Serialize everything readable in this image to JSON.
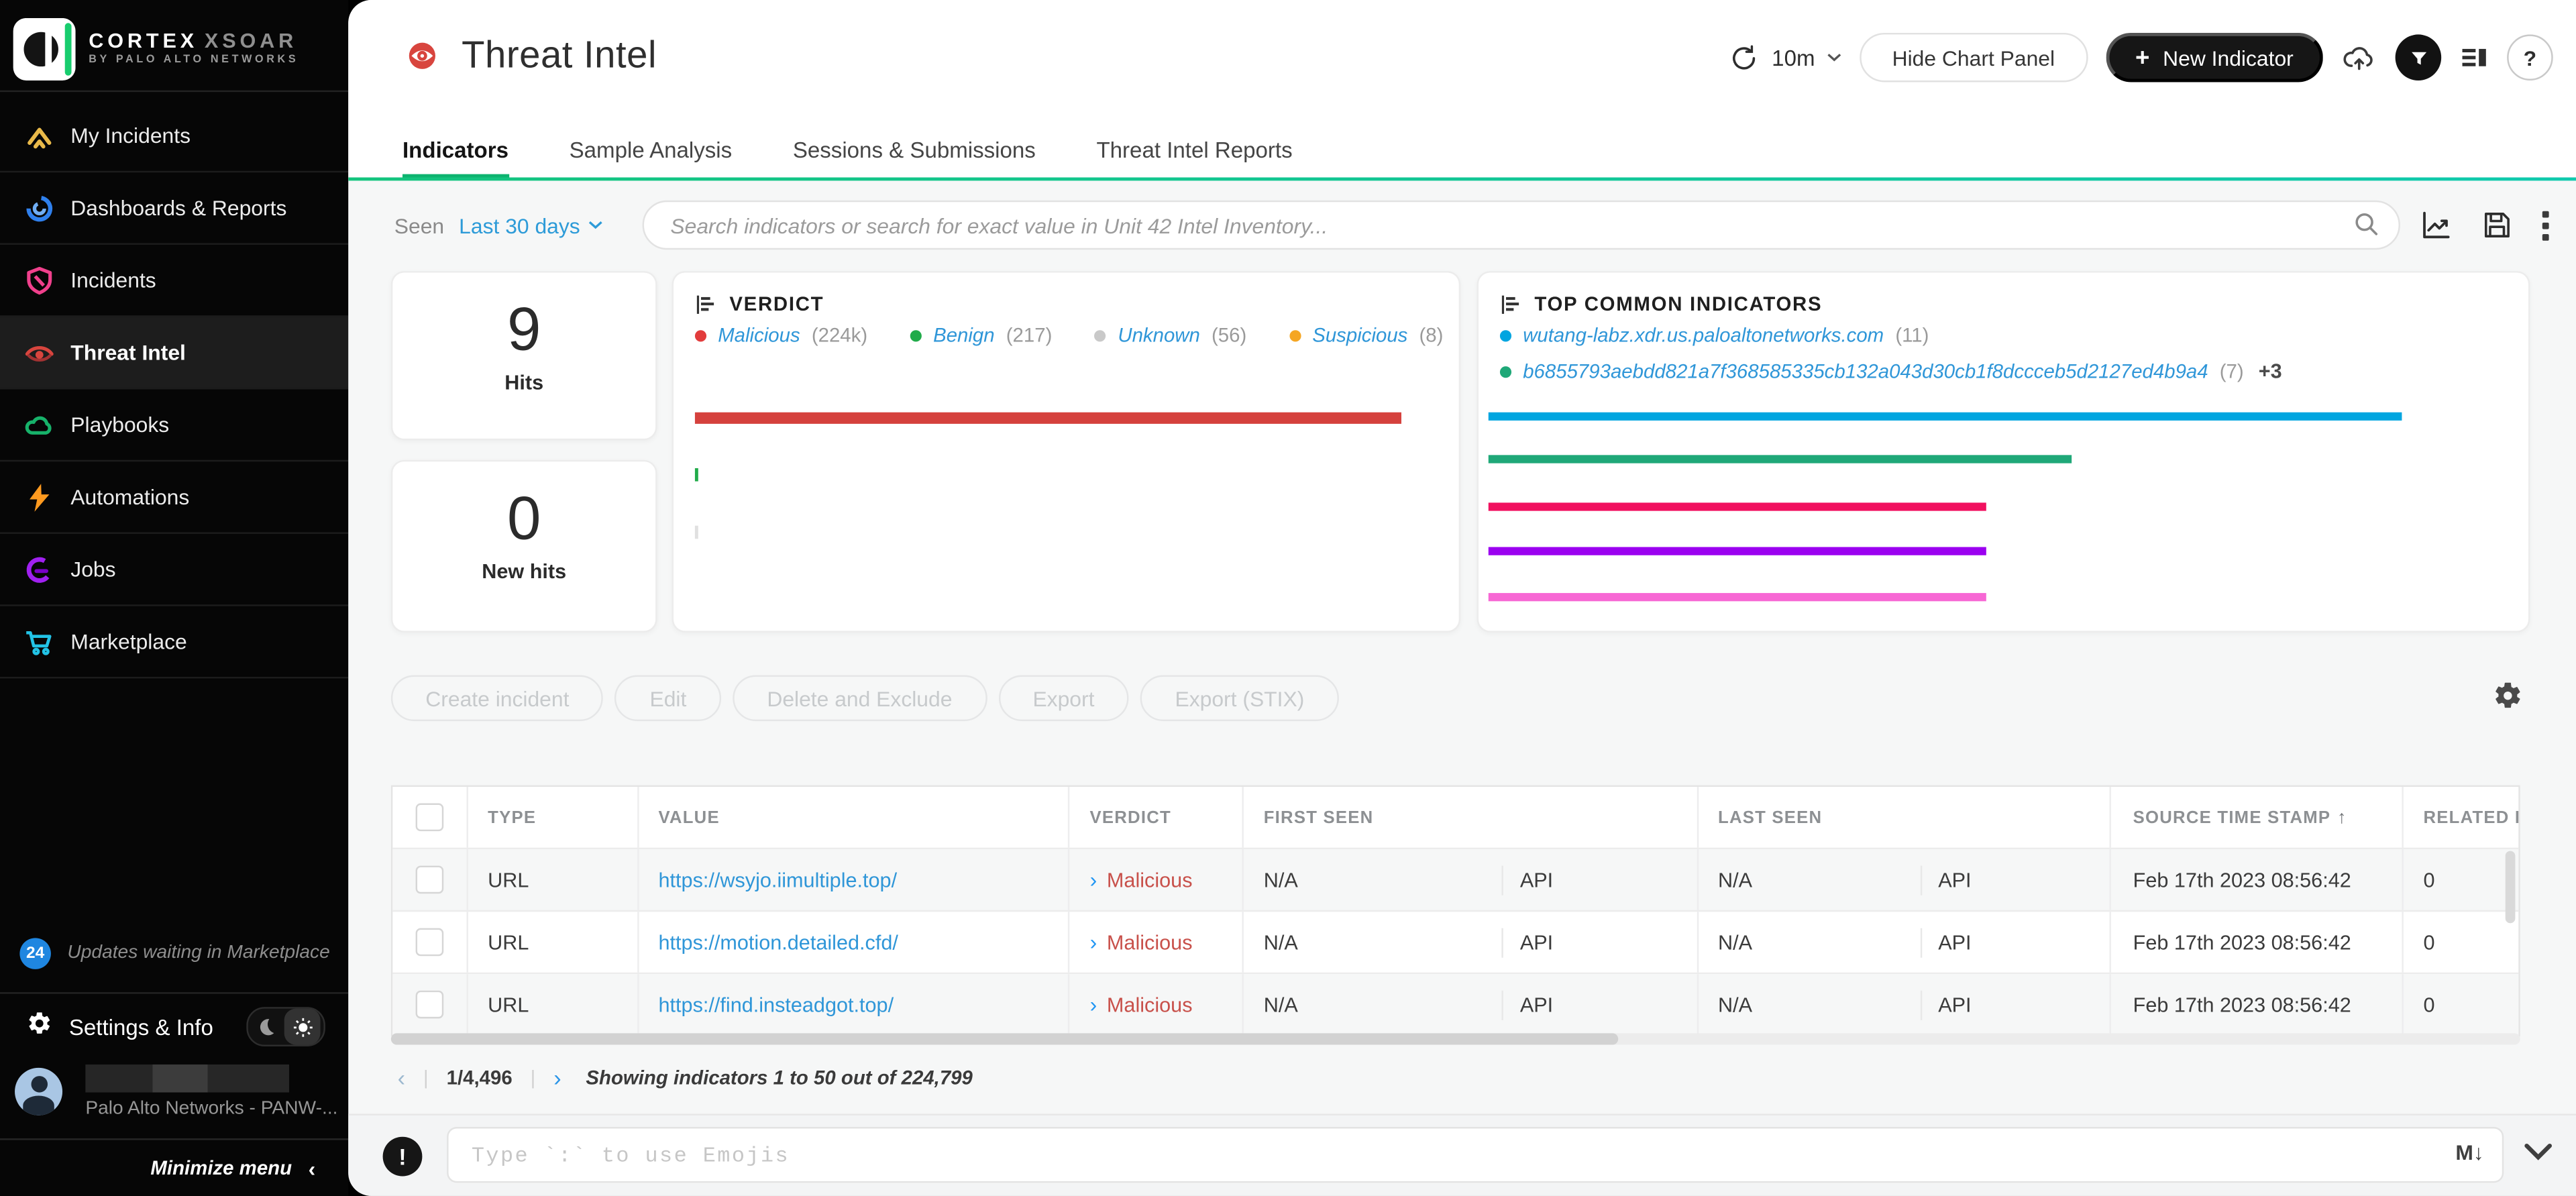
{
  "brand": {
    "product": "CORTEX",
    "suite": "XSOAR",
    "tagline": "BY PALO ALTO NETWORKS"
  },
  "sidebar": {
    "items": [
      {
        "label": "My Incidents"
      },
      {
        "label": "Dashboards & Reports"
      },
      {
        "label": "Incidents"
      },
      {
        "label": "Threat Intel"
      },
      {
        "label": "Playbooks"
      },
      {
        "label": "Automations"
      },
      {
        "label": "Jobs"
      },
      {
        "label": "Marketplace"
      }
    ],
    "footer": {
      "updates_count": "24",
      "updates_text": "Updates waiting in Marketplace",
      "settings_label": "Settings & Info",
      "org": "Palo Alto Networks - PANW-...",
      "minimize_label": "Minimize menu",
      "minimize_chevron": "‹"
    }
  },
  "header": {
    "title": "Threat Intel",
    "refresh_interval": "10m",
    "hide_chart_button": "Hide Chart Panel",
    "plus": "+",
    "new_indicator_button": "New Indicator",
    "help": "?"
  },
  "tabs": [
    {
      "label": "Indicators"
    },
    {
      "label": "Sample Analysis"
    },
    {
      "label": "Sessions & Submissions"
    },
    {
      "label": "Threat Intel Reports"
    }
  ],
  "filter_bar": {
    "seen_label": "Seen",
    "seen_value": "Last 30 days",
    "search_placeholder": "Search indicators or search for exact value in Unit 42 Intel Inventory..."
  },
  "panels": {
    "hits": {
      "value": "9",
      "label": "Hits"
    },
    "new_hits": {
      "value": "0",
      "label": "New hits"
    },
    "verdict": {
      "title": "VERDICT",
      "legend": [
        {
          "name": "Malicious",
          "count": "(224k)",
          "color": "#e23c3c"
        },
        {
          "name": "Benign",
          "count": "(217)",
          "color": "#21ab4a"
        },
        {
          "name": "Unknown",
          "count": "(56)",
          "color": "#c9c9c9"
        },
        {
          "name": "Suspicious",
          "count": "(8)",
          "color": "#f5a623"
        }
      ],
      "bars": [
        {
          "color": "#d5413d",
          "width_pct": 100
        },
        {
          "color": "#21ab4a",
          "width_pct": 0.4
        },
        {
          "color": "#e0e0e0",
          "width_pct": 0.4
        }
      ]
    },
    "top_common": {
      "title": "TOP COMMON INDICATORS",
      "legend": [
        {
          "name": "wutang-labz.xdr.us.paloaltonetworks.com",
          "count": "(11)",
          "color": "#00a5e0"
        },
        {
          "name": "b6855793aebdd821a7f368585335cb132a043d30cb1f8dccceb5d2127ed4b9a4",
          "count": "(7)",
          "color": "#1fa878",
          "extra": "+3"
        }
      ],
      "bars": [
        {
          "color": "#00a5e0",
          "width_pct": 100
        },
        {
          "color": "#1fa878",
          "width_pct": 63.9
        },
        {
          "color": "#f1115f",
          "width_pct": 54.5
        },
        {
          "color": "#9b00f0",
          "width_pct": 54.5
        },
        {
          "color": "#f767d4",
          "width_pct": 54.5
        }
      ]
    }
  },
  "chart_data": [
    {
      "type": "bar",
      "orientation": "horizontal",
      "title": "VERDICT",
      "categories": [
        "Malicious",
        "Benign",
        "Unknown",
        "Suspicious"
      ],
      "values": [
        224000,
        217,
        56,
        8
      ],
      "value_labels": [
        "224k",
        "217",
        "56",
        "8"
      ],
      "colors": [
        "#d5413d",
        "#21ab4a",
        "#c9c9c9",
        "#f5a623"
      ],
      "legend_position": "top",
      "grid": false
    },
    {
      "type": "bar",
      "orientation": "horizontal",
      "title": "TOP COMMON INDICATORS",
      "categories": [
        "wutang-labz.xdr.us.paloaltonetworks.com",
        "b6855793aebdd821a7f368585335cb132a043d30cb1f8dccceb5d2127ed4b9a4",
        "(unlabeled)",
        "(unlabeled)",
        "(unlabeled)"
      ],
      "values": [
        11,
        7,
        6,
        6,
        6
      ],
      "colors": [
        "#00a5e0",
        "#1fa878",
        "#f1115f",
        "#9b00f0",
        "#f767d4"
      ],
      "legend_position": "top",
      "grid": false
    }
  ],
  "actions": {
    "buttons": [
      "Create incident",
      "Edit",
      "Delete and Exclude",
      "Export",
      "Export (STIX)"
    ]
  },
  "table": {
    "headers": {
      "type": "TYPE",
      "value": "VALUE",
      "verdict": "VERDICT",
      "first_seen": "FIRST SEEN",
      "last_seen": "LAST SEEN",
      "source_time_stamp": "SOURCE TIME STAMP",
      "sort_arrow": "↑",
      "related": "RELATED INC"
    },
    "rows": [
      {
        "type": "URL",
        "value": "https://wsyjo.iimultiple.top/",
        "verdict_chevron": "›",
        "verdict": "Malicious",
        "first_seen": "N/A",
        "first_seen_source": "API",
        "last_seen": "N/A",
        "last_seen_source": "API",
        "source_time_stamp": "Feb 17th 2023 08:56:42",
        "related_incidents": "0"
      },
      {
        "type": "URL",
        "value": "https://motion.detailed.cfd/",
        "verdict_chevron": "›",
        "verdict": "Malicious",
        "first_seen": "N/A",
        "first_seen_source": "API",
        "last_seen": "N/A",
        "last_seen_source": "API",
        "source_time_stamp": "Feb 17th 2023 08:56:42",
        "related_incidents": "0"
      },
      {
        "type": "URL",
        "value": "https://find.insteadgot.top/",
        "verdict_chevron": "›",
        "verdict": "Malicious",
        "first_seen": "N/A",
        "first_seen_source": "API",
        "last_seen": "N/A",
        "last_seen_source": "API",
        "source_time_stamp": "Feb 17th 2023 08:56:42",
        "related_incidents": "0"
      }
    ]
  },
  "pagination": {
    "prev": "‹",
    "sep": "|",
    "page": "1/4,496",
    "next": "›",
    "summary": "Showing indicators 1 to 50 out of 224,799"
  },
  "composer": {
    "alert": "!",
    "placeholder": "Type `:` to use Emojis",
    "markdown_label": "M↓"
  }
}
